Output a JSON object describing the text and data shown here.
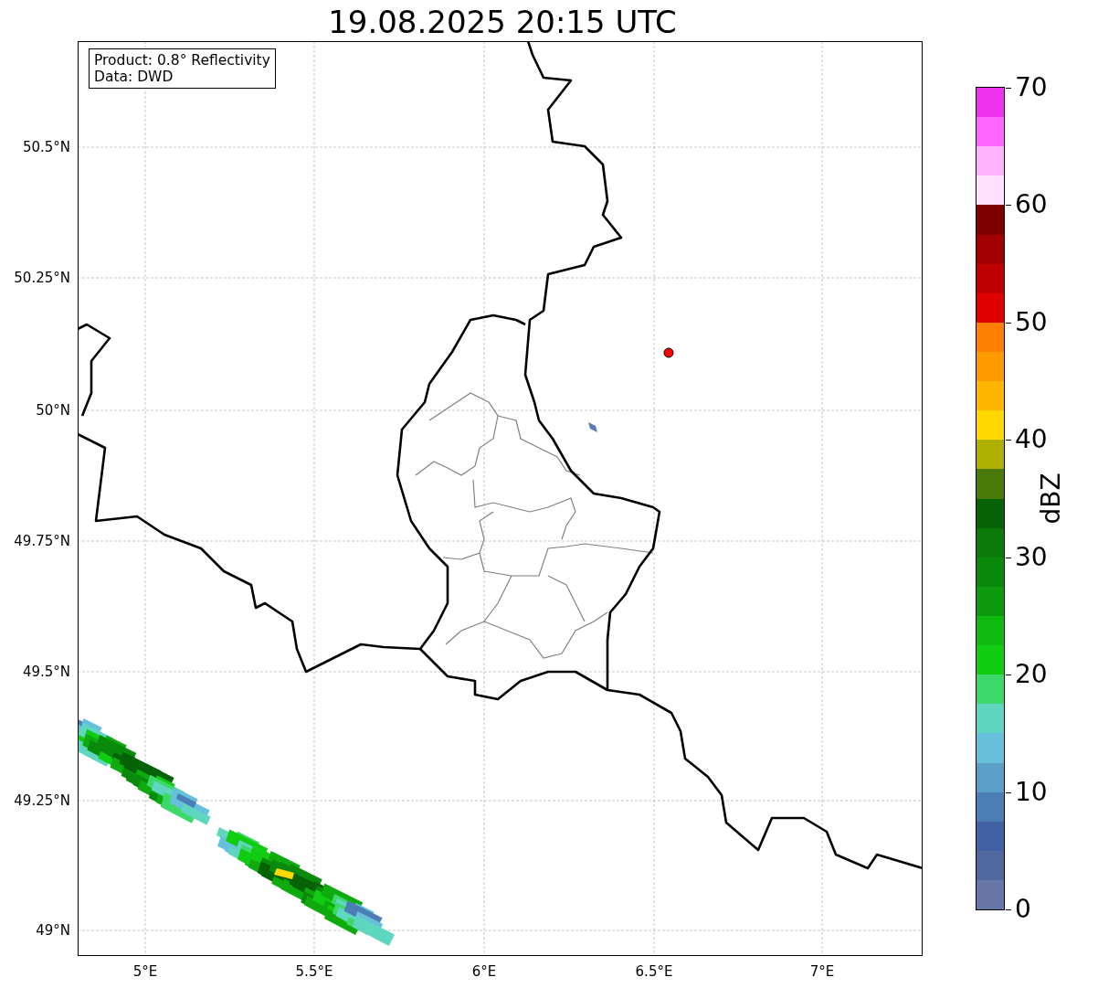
{
  "title": "19.08.2025 20:15 UTC",
  "info_box": {
    "lines": [
      "Product: 0.8° Reflectivity",
      "Data: DWD"
    ]
  },
  "y_ticks": [
    "50.5°N",
    "50.25°N",
    "50°N",
    "49.75°N",
    "49.5°N",
    "49.25°N",
    "49°N"
  ],
  "x_ticks": [
    "5°E",
    "5.5°E",
    "6°E",
    "6.5°E",
    "7°E"
  ],
  "colorbar": {
    "label": "dBZ",
    "ticks": [
      "70",
      "60",
      "50",
      "40",
      "30",
      "20",
      "10",
      "0"
    ],
    "bins": [
      {
        "color": "#ee33ee"
      },
      {
        "color": "#ff66ff"
      },
      {
        "color": "#ffb3ff"
      },
      {
        "color": "#ffe0ff"
      },
      {
        "color": "#7f0000"
      },
      {
        "color": "#a00000"
      },
      {
        "color": "#c00000"
      },
      {
        "color": "#e00000"
      },
      {
        "color": "#ff7f00"
      },
      {
        "color": "#ff9900"
      },
      {
        "color": "#ffb600"
      },
      {
        "color": "#ffd800"
      },
      {
        "color": "#b0b000"
      },
      {
        "color": "#4a7a0a"
      },
      {
        "color": "#056305"
      },
      {
        "color": "#0a7a0a"
      },
      {
        "color": "#0a8a0a"
      },
      {
        "color": "#0c9a0c"
      },
      {
        "color": "#10bb10"
      },
      {
        "color": "#12cc12"
      },
      {
        "color": "#3dd86a"
      },
      {
        "color": "#5fd6c0"
      },
      {
        "color": "#66c0dc"
      },
      {
        "color": "#5a9fc8"
      },
      {
        "color": "#4a7eb4"
      },
      {
        "color": "#4260a4"
      },
      {
        "color": "#5269a0"
      },
      {
        "color": "#6677a8"
      }
    ]
  }
}
